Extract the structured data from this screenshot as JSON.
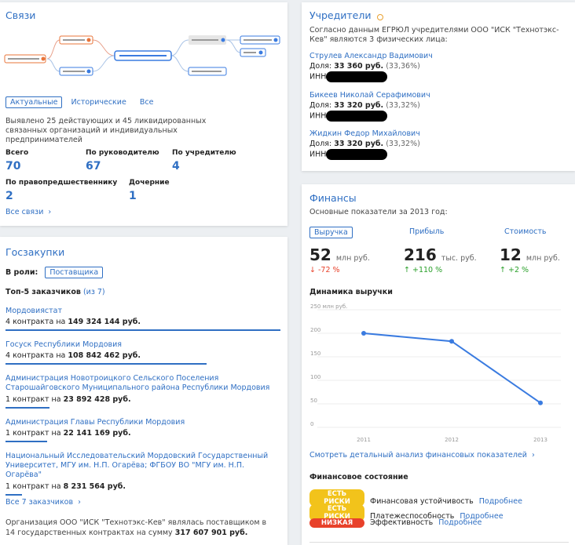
{
  "svyazi": {
    "title": "Связи",
    "tabs": [
      "Актуальные",
      "Исторические",
      "Все"
    ],
    "description": "Выявлено 25 действующих и 45 ликвидированных связанных организаций и индивидуальных предпринимателей",
    "stats": [
      {
        "label": "Всего",
        "value": "70"
      },
      {
        "label": "По руководителю",
        "value": "67"
      },
      {
        "label": "По учредителю",
        "value": "4"
      },
      {
        "label": "По правопредшественнику",
        "value": "2"
      },
      {
        "label": "Дочерние",
        "value": "1"
      }
    ],
    "all_link": "Все связи"
  },
  "goszakupki": {
    "title": "Госзакупки",
    "role_label": "В роли:",
    "role_value": "Поставщика",
    "top_label": "Топ-5 заказчиков",
    "top_count": "(из 7)",
    "customers": [
      {
        "name": "Мордовиястат",
        "count": "4 контракта на",
        "sum": "149 324 144 руб.",
        "share": 1.0
      },
      {
        "name": "Госуск Республики Мордовия",
        "count": "4 контракта на",
        "sum": "108 842 462 руб.",
        "share": 0.73
      },
      {
        "name": "Администрация Новотроицкого Сельского Поселения Старошайговского Муниципального района Республики Мордовия",
        "count": "1 контракт на",
        "sum": "23 892 428 руб.",
        "share": 0.16
      },
      {
        "name": "Администрация Главы Республики Мордовия",
        "count": "1 контракт на",
        "sum": "22 141 169 руб.",
        "share": 0.15
      },
      {
        "name": "Национальный Исследовательский Мордовский Государственный Университет, МГУ им. Н.П. Огарёва; ФГБОУ ВО \"МГУ им. Н.П. Огарёва\"",
        "count": "1 контракт на",
        "sum": "8 231 564 руб.",
        "share": 0.06
      }
    ],
    "all_link": "Все 7 заказчиков",
    "footer": "Организация ООО \"ИСК \"Технотэкс-Кев\" являлась поставщиком в 14 государственных контрактах на сумму",
    "footer_sum": "317 607 901 руб."
  },
  "founders": {
    "title": "Учредители",
    "intro": "Согласно данным ЕГРЮЛ учредителями ООО \"ИСК \"Технотэкс-Кев\" являются 3 физических лица:",
    "share_label": "Доля:",
    "inn_label": "ИНН:",
    "people": [
      {
        "name": "Струлев Александр Вадимович",
        "amount": "33 360 руб.",
        "percent": "(33,36%)"
      },
      {
        "name": "Бикеев Николай Серафимович",
        "amount": "33 320 руб.",
        "percent": "(33,32%)"
      },
      {
        "name": "Жидкин Федор Михайлович",
        "amount": "33 320 руб.",
        "percent": "(33,32%)"
      }
    ]
  },
  "finance": {
    "title": "Финансы",
    "subtitle": "Основные показатели за 2013 год:",
    "tabs": [
      "Выручка",
      "Прибыль",
      "Стоимость"
    ],
    "metrics": [
      {
        "value": "52",
        "unit": "млн руб.",
        "change": "↓ -72 %",
        "direction": "down"
      },
      {
        "value": "216",
        "unit": "тыс. руб.",
        "change": "↑ +110 %",
        "direction": "up"
      },
      {
        "value": "12",
        "unit": "млн руб.",
        "change": "↑ +2 %",
        "direction": "up"
      }
    ],
    "chart_heading": "Динамика выручки",
    "analysis_link": "Смотреть детальный анализ финансовых показателей",
    "state_heading": "Финансовое состояние",
    "states": [
      {
        "badge": "ЕСТЬ РИСКИ",
        "color": "#f2c31b",
        "label": "Финансовая устойчивость",
        "more": "Подробнее"
      },
      {
        "badge": "ЕСТЬ РИСКИ",
        "color": "#f2c31b",
        "label": "Платежеспособность",
        "more": "Подробнее"
      },
      {
        "badge": "НИЗКАЯ",
        "color": "#e8412a",
        "label": "Эффективность",
        "more": "Подробнее"
      }
    ]
  },
  "chart_data": {
    "type": "line",
    "title": "Динамика выручки",
    "ylabel_unit": "250 млн руб.",
    "x": [
      "2011",
      "2012",
      "2013"
    ],
    "series": [
      {
        "values": [
          200,
          183,
          52
        ]
      }
    ],
    "yticks": [
      "250 млн руб.",
      "200",
      "150",
      "100",
      "50",
      "0"
    ],
    "ylim": [
      0,
      250
    ],
    "grid": true,
    "color": "#3a7be0"
  },
  "colors": {
    "accent": "#2f6fc3",
    "graph_red": "#e8743a",
    "up": "#2aa02a",
    "down": "#e8412a"
  }
}
